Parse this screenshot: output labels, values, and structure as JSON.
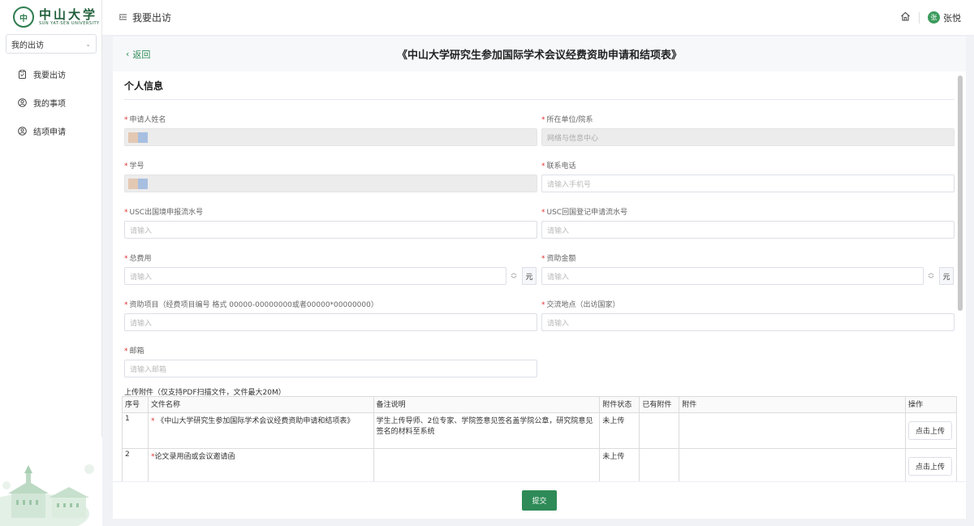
{
  "brand": {
    "seal": "中",
    "name_cn": "中山大学",
    "name_en": "SUN YAT-SEN UNIVERSITY"
  },
  "sidebar": {
    "select_value": "我的出访",
    "items": [
      {
        "label": "我要出访",
        "icon": "clipboard-icon"
      },
      {
        "label": "我的事项",
        "icon": "user-circle-icon"
      },
      {
        "label": "结项申请",
        "icon": "user-circle-icon"
      }
    ]
  },
  "topbar": {
    "breadcrumb": "我要出访",
    "user_name": "张悦",
    "avatar_initial": "张"
  },
  "card": {
    "back_label": "返回",
    "title": "《中山大学研究生参加国际学术会议经费资助申请和结项表》",
    "section_title": "个人信息"
  },
  "form": {
    "applicant_name": {
      "label": "申请人姓名"
    },
    "department": {
      "label": "所在单位/院系",
      "value": "网络与信息中心"
    },
    "student_id": {
      "label": "学号"
    },
    "phone": {
      "label": "联系电话",
      "placeholder": "请输入手机号"
    },
    "usc_exit": {
      "label": "USC出国境申报流水号",
      "placeholder": "请输入"
    },
    "usc_return": {
      "label": "USC回国登记申请流水号",
      "placeholder": "请输入"
    },
    "total_cost": {
      "label": "总费用",
      "placeholder": "请输入",
      "unit": "元"
    },
    "funding_amount": {
      "label": "资助金额",
      "placeholder": "请输入",
      "unit": "元"
    },
    "funding_project": {
      "label": "资助项目（经费项目编号 格式 00000-00000000或者00000*00000000）",
      "placeholder": "请输入"
    },
    "exchange_location": {
      "label": "交流地点（出访国家）",
      "placeholder": "请输入"
    },
    "email": {
      "label": "邮箱",
      "placeholder": "请输入邮箱"
    }
  },
  "attachments": {
    "title": "上传附件（仅支持PDF扫描文件，文件最大20M）",
    "columns": [
      "序号",
      "文件名称",
      "备注说明",
      "附件状态",
      "已有附件",
      "附件",
      "操作"
    ],
    "rows": [
      {
        "no": "1",
        "name": "《中山大学研究生参加国际学术会议经费资助申请和结项表》",
        "note": "学生上传导师、2位专家、学院签意见签名盖学院公章，研究院意见签名的材料至系统",
        "status": "未上传",
        "action": "点击上传"
      },
      {
        "no": "2",
        "name": "论文录用函或会议邀请函",
        "note": "",
        "status": "未上传",
        "action": "点击上传"
      }
    ]
  },
  "footer": {
    "submit_label": "提交"
  },
  "colors": {
    "primary": "#2e8b57",
    "required": "#e03131"
  }
}
